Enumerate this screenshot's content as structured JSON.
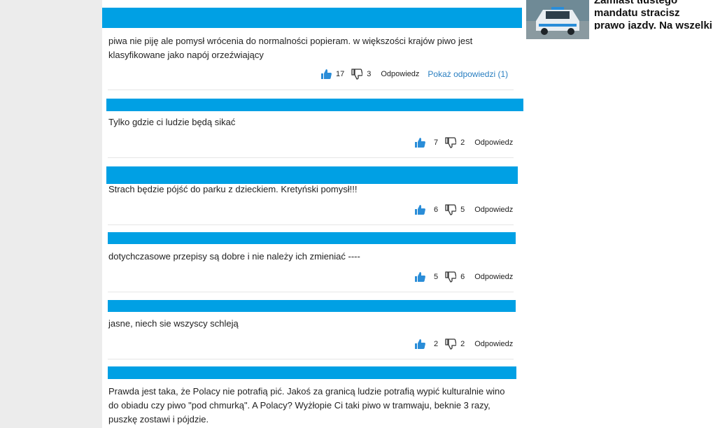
{
  "comments": [
    {
      "text": "piwa nie piję ale pomysł wrócenia do normalności popieram. w większości krajów piwo jest klasyfikowane jako napój orzeźwiający",
      "likes": "17",
      "dislikes": "3",
      "reply": "Odpowiedz",
      "show_replies": "Pokaż odpowiedzi (1)"
    },
    {
      "text": "Tylko gdzie ci ludzie będą sikać",
      "likes": "7",
      "dislikes": "2",
      "reply": "Odpowiedz"
    },
    {
      "text": "Strach będzie pójść do parku z dzieckiem. Kretyński pomysł!!!",
      "likes": "6",
      "dislikes": "5",
      "reply": "Odpowiedz"
    },
    {
      "text": "dotychczasowe przepisy są dobre i nie należy ich zmieniać ----",
      "likes": "5",
      "dislikes": "6",
      "reply": "Odpowiedz"
    },
    {
      "text": "jasne, niech sie wszyscy schleją",
      "likes": "2",
      "dislikes": "2",
      "reply": "Odpowiedz"
    },
    {
      "text": "Prawda jest taka, że Polacy nie potrafią pić. Jakoś za granicą ludzie potrafią wypić kulturalnie wino do obiadu czy piwo \"pod chmurką\". A Polacy? Wyżłopie Ci taki piwo w tramwaju, beknie 3 razy, puszkę zostawi i pójdzie."
    }
  ],
  "sidebar": {
    "article_title": "Zamiast tłustego mandatu stracisz prawo jazdy. Na wszelki wypadek",
    "thumb_icon": "police-car-photo"
  },
  "colors": {
    "accent_bar": "#00a0e4",
    "link": "#2a7fc1",
    "thumb_icon": "#2a8dd8"
  }
}
